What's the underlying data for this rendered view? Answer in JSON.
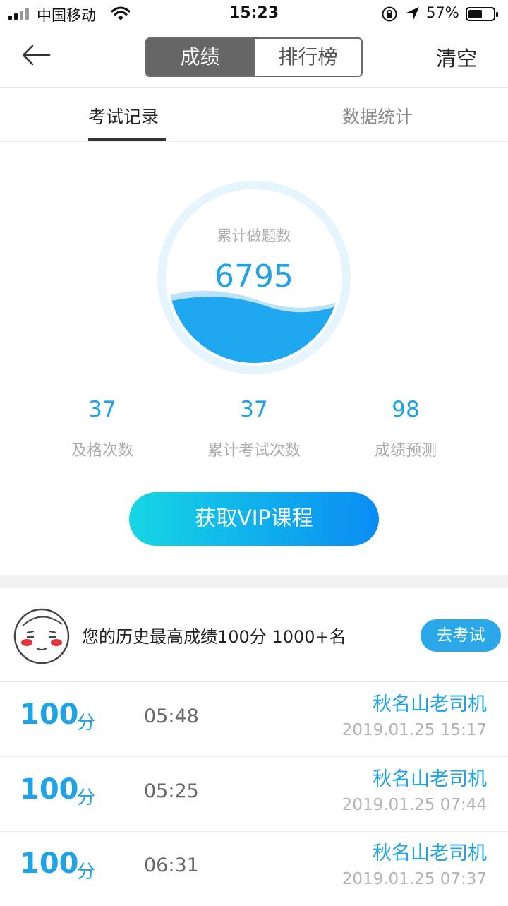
{
  "status_bar": {
    "carrier": "中国移动",
    "time": "15:23",
    "battery": "57%",
    "battery_level": 0.57
  },
  "nav": {
    "back_icon": "back-arrow-icon",
    "tabs": [
      "成绩",
      "排行榜"
    ],
    "active_tab": 0,
    "clear_label": "清空"
  },
  "sub_tabs": {
    "tabs": [
      "考试记录",
      "数据统计"
    ],
    "active": 0
  },
  "gauge": {
    "label": "累计做题数",
    "value": "6795"
  },
  "stats": [
    {
      "value": "37",
      "label": "及格次数"
    },
    {
      "value": "37",
      "label": "累计考试次数"
    },
    {
      "value": "98",
      "label": "成绩预测"
    }
  ],
  "vip_button": "获取VIP课程",
  "best": {
    "avatar_icon": "cartoon-avatar-icon",
    "text": "您的历史最高成绩100分 1000+名",
    "button": "去考试"
  },
  "records": [
    {
      "score": "100",
      "unit": "分",
      "duration": "05:48",
      "name": "秋名山老司机",
      "date": "2019.01.25 15:17"
    },
    {
      "score": "100",
      "unit": "分",
      "duration": "05:25",
      "name": "秋名山老司机",
      "date": "2019.01.25 07:44"
    },
    {
      "score": "100",
      "unit": "分",
      "duration": "06:31",
      "name": "秋名山老司机",
      "date": "2019.01.25 07:37"
    }
  ],
  "colors": {
    "accent": "#1ea2e8",
    "vip_start": "#16d6e4",
    "vip_end": "#0a8cf4",
    "segment_active": "#666666"
  }
}
